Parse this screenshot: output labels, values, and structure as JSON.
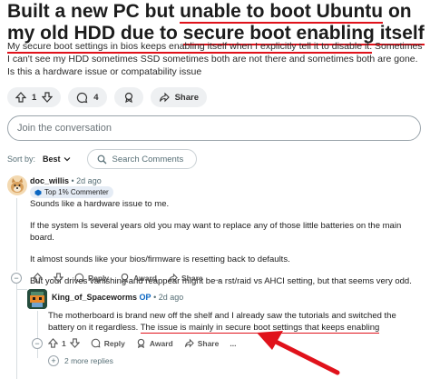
{
  "post": {
    "title_pre": "Built a new PC but ",
    "title_underlined": "unable to boot Ubuntu",
    "title_mid": " on my old HDD due to ",
    "title_underlined2": "secure boot enabling itself",
    "body_underlined": "My secure boot settings in bios keeps enabling itself when I explicitly tell it to disable it.",
    "body_rest": " Sometimes I can't see my HDD sometimes SSD sometimes both are not there and sometimes both are gone. Is this a hardware issue or compatability issue",
    "upvotes": "1",
    "comments": "4",
    "share_label": "Share"
  },
  "join_placeholder": "Join the conversation",
  "sort": {
    "label": "Sort by:",
    "value": "Best"
  },
  "search_label": "Search Comments",
  "comment1": {
    "user": "doc_willis",
    "time": "2d ago",
    "flair": "Top 1% Commenter",
    "p1": "Sounds like a hardware issue to me.",
    "p2": "If the system Is several years old you may want to replace any of those little batteries on the main board.",
    "p3": "It almost sounds like your bios/firmware is resetting back to defaults.",
    "p4": "But your drives  vanishing and reappear might be a rst/raid  vs AHCI setting,   but that seems very odd.",
    "reply": "Reply",
    "award": "Award",
    "share": "Share",
    "more": "..."
  },
  "comment2": {
    "user": "King_of_Spaceworms",
    "op": "OP",
    "time": "2d ago",
    "p1": "The motherboard is brand new off the shelf and I already saw the tutorials and switched the battery on it regardless. ",
    "p1_underlined": "The issue is mainly in secure boot settings that keeps enabling",
    "upvotes": "1",
    "reply": "Reply",
    "award": "Award",
    "share": "Share",
    "more": "..."
  },
  "more_replies": "2 more replies",
  "colors": {
    "annotation": "#e0121b",
    "accent": "#0a66c2"
  }
}
